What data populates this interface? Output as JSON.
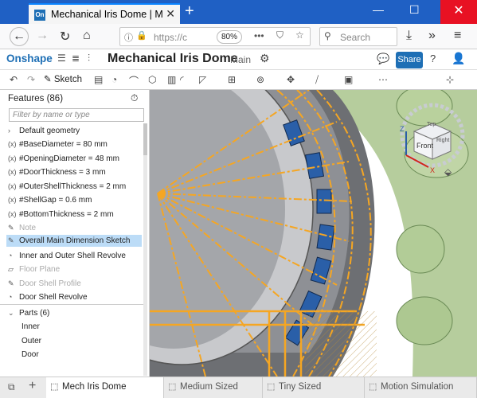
{
  "browser": {
    "tab_title": "Mechanical Iris Dome | Mech Ir",
    "tab_icon": "On",
    "new_tab": "+",
    "url": "https://c",
    "zoom": "80%",
    "search_placeholder": "Search"
  },
  "app": {
    "logo": "Onshape",
    "doc_title": "Mechanical Iris Dome",
    "branch": "Main",
    "share_label": "Share"
  },
  "toolbar": {
    "sketch_label": "Sketch"
  },
  "panel": {
    "title": "Features (86)",
    "filter_placeholder": "Filter by name or type",
    "default_geometry": "Default geometry",
    "features": [
      {
        "label": "#BaseDiameter = 80 mm",
        "icon": "(x)"
      },
      {
        "label": "#OpeningDiameter = 48 mm",
        "icon": "(x)"
      },
      {
        "label": "#DoorThickness = 3 mm",
        "icon": "(x)"
      },
      {
        "label": "#OuterShellThickness = 2 mm",
        "icon": "(x)"
      },
      {
        "label": "#ShellGap = 0.6 mm",
        "icon": "(x)"
      },
      {
        "label": "#BottomThickness = 2 mm",
        "icon": "(x)"
      },
      {
        "label": "Note",
        "icon": "pencil"
      },
      {
        "label": "Overall Main Dimension Sketch",
        "icon": "pencil"
      },
      {
        "label": "Inner and Outer Shell Revolve",
        "icon": "revolve"
      },
      {
        "label": "Floor Plane",
        "icon": "plane"
      },
      {
        "label": "Door Shell Profile",
        "icon": "pencil"
      },
      {
        "label": "Door Shell Revolve",
        "icon": "revolve"
      }
    ],
    "parts_header": "Parts (6)",
    "parts": [
      "Inner",
      "Outer",
      "Door"
    ]
  },
  "bottom_tabs": [
    {
      "label": "Mech Iris Dome",
      "active": true
    },
    {
      "label": "Medium Sized",
      "active": false
    },
    {
      "label": "Tiny Sized",
      "active": false
    },
    {
      "label": "Motion Simulation",
      "active": false
    }
  ],
  "viewcube": {
    "front": "Front",
    "top": "Top",
    "right": "Right",
    "axis_z": "Z",
    "axis_x": "X"
  },
  "colors": {
    "accent": "#1e6fb5",
    "sketch_orange": "#f5a623",
    "door_blue": "#2a5fa8",
    "shell_green": "#9cbf7a",
    "firefox_blue": "#1f60c4"
  }
}
